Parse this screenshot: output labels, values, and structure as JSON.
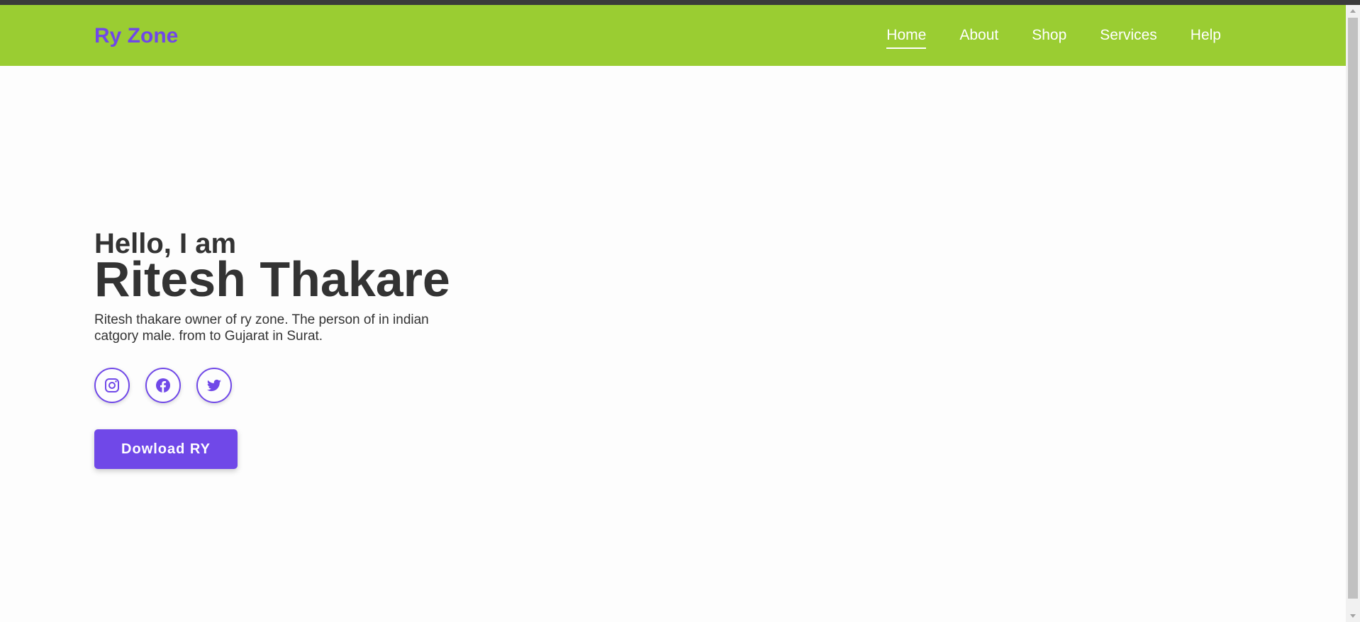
{
  "navbar": {
    "logo": "Ry Zone",
    "links": [
      {
        "label": "Home",
        "active": true
      },
      {
        "label": "About",
        "active": false
      },
      {
        "label": "Shop",
        "active": false
      },
      {
        "label": "Services",
        "active": false
      },
      {
        "label": "Help",
        "active": false
      }
    ]
  },
  "hero": {
    "greeting": "Hello, I am",
    "name": "Ritesh Thakare",
    "bio": "Ritesh thakare owner of ry zone. The person of in indian catgory male. from to Gujarat in Surat.",
    "socials": [
      {
        "icon": "instagram-icon"
      },
      {
        "icon": "facebook-icon"
      },
      {
        "icon": "twitter-icon"
      }
    ],
    "download_label": "Dowload RY"
  },
  "colors": {
    "navbar_bg": "#9acd32",
    "accent": "#7048e8",
    "text": "#333333",
    "page_bg": "#fdfdfd"
  }
}
